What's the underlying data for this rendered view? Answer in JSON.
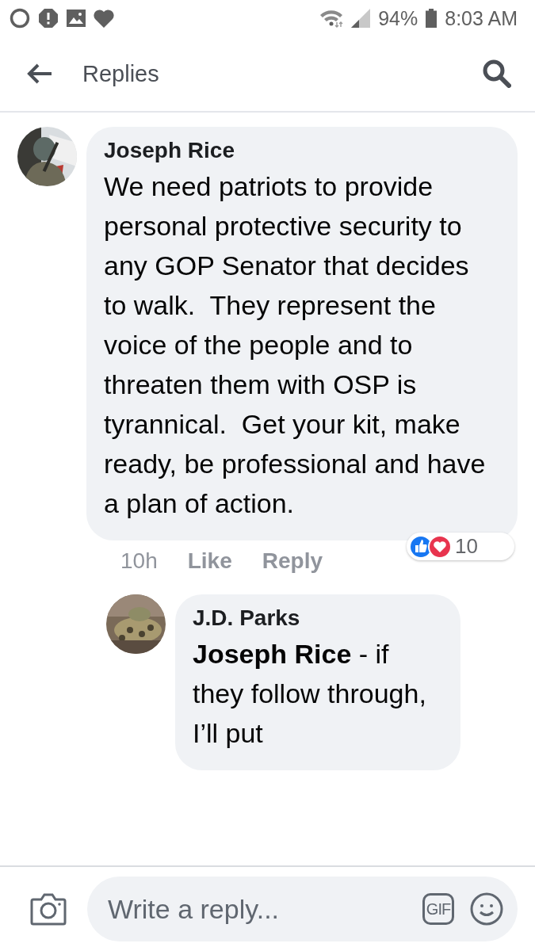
{
  "status_bar": {
    "battery_percent": "94%",
    "time": "8:03 AM"
  },
  "header": {
    "title": "Replies"
  },
  "comments": [
    {
      "author": "Joseph Rice",
      "text": "We need patriots to provide personal protective security to any GOP Senator that decides to walk.  They represent the voice of the people and to threaten them with OSP is tyrannical.  Get your kit, make ready, be professional and have a plan of action.",
      "time": "10h",
      "actions": [
        "Like",
        "Reply"
      ],
      "reaction_count": "10",
      "replies": [
        {
          "author": "J.D. Parks",
          "text": "**Joseph Rice** - if they follow through, I’ll put"
        }
      ]
    }
  ],
  "composer": {
    "placeholder": "Write a reply...",
    "gif_label": "GIF"
  }
}
